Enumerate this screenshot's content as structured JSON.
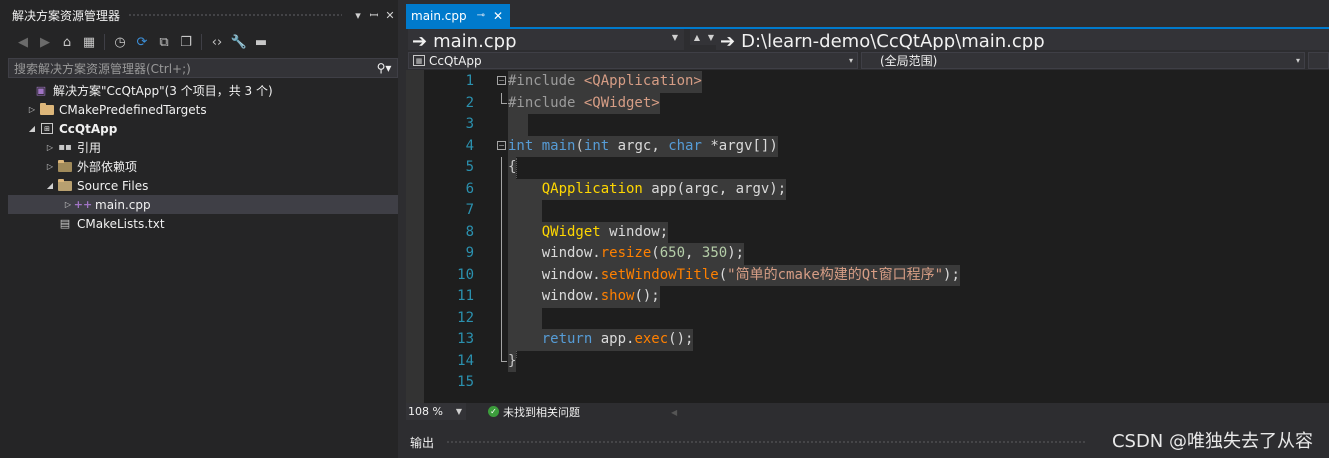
{
  "solution_explorer": {
    "title": "解决方案资源管理器",
    "controls": [
      "▾",
      "ꟷ",
      "✕"
    ],
    "search_placeholder": "搜索解决方案资源管理器(Ctrl+;)",
    "tree": [
      {
        "label": "解决方案\"CcQtApp\"(3 个项目，共 3 个)",
        "icon": "solution-icon",
        "indent": 0,
        "arrow": ""
      },
      {
        "label": "CMakePredefinedTargets",
        "icon": "folder-icon",
        "indent": 1,
        "arrow": "▷"
      },
      {
        "label": "CcQtApp",
        "icon": "project-icon",
        "indent": 1,
        "arrow": "◢",
        "bold": true
      },
      {
        "label": "引用",
        "icon": "references-icon",
        "indent": 2,
        "arrow": "▷"
      },
      {
        "label": "外部依赖项",
        "icon": "external-deps-icon",
        "indent": 2,
        "arrow": "▷"
      },
      {
        "label": "Source Files",
        "icon": "filter-folder-icon",
        "indent": 2,
        "arrow": "◢"
      },
      {
        "label": "main.cpp",
        "icon": "cpp-file-icon",
        "indent": 3,
        "arrow": "▷",
        "selected": true
      },
      {
        "label": "CMakeLists.txt",
        "icon": "text-file-icon",
        "indent": 2,
        "arrow": ""
      }
    ]
  },
  "editor": {
    "tab": {
      "label": "main.cpp",
      "pin": "⊸",
      "close": "✕"
    },
    "nav_file": "main.cpp",
    "nav_path": "D:\\learn-demo\\CcQtApp\\main.cpp",
    "scope_project": "CcQtApp",
    "scope_range": "(全局范围)",
    "line_numbers": [
      "1",
      "2",
      "3",
      "4",
      "5",
      "6",
      "7",
      "8",
      "9",
      "10",
      "11",
      "12",
      "13",
      "14",
      "15"
    ],
    "zoom": "108 %",
    "issues": "未找到相关问题"
  },
  "code_lines": [
    [
      {
        "t": "#include ",
        "c": "pre"
      },
      {
        "t": "<QApplication>",
        "c": "inc"
      }
    ],
    [
      {
        "t": "#include ",
        "c": "pre"
      },
      {
        "t": "<QWidget>",
        "c": "inc"
      }
    ],
    [
      {
        "t": "",
        "c": "pm"
      }
    ],
    [
      {
        "t": "int",
        "c": "kw"
      },
      {
        "t": " ",
        "c": "pm"
      },
      {
        "t": "main",
        "c": "kw"
      },
      {
        "t": "(",
        "c": "pm"
      },
      {
        "t": "int",
        "c": "kw"
      },
      {
        "t": " argc, ",
        "c": "vr"
      },
      {
        "t": "char",
        "c": "kw"
      },
      {
        "t": " *argv[])",
        "c": "vr"
      }
    ],
    [
      {
        "t": "{",
        "c": "pm"
      }
    ],
    [
      {
        "t": "    ",
        "c": "pm"
      },
      {
        "t": "QApplication",
        "c": "ty"
      },
      {
        "t": " app(argc, argv);",
        "c": "vr"
      }
    ],
    [
      {
        "t": "    ",
        "c": "pm"
      }
    ],
    [
      {
        "t": "    ",
        "c": "pm"
      },
      {
        "t": "QWidget",
        "c": "ty"
      },
      {
        "t": " window;",
        "c": "vr"
      }
    ],
    [
      {
        "t": "    window.",
        "c": "vr"
      },
      {
        "t": "resize",
        "c": "fn"
      },
      {
        "t": "(",
        "c": "vr"
      },
      {
        "t": "650",
        "c": "num"
      },
      {
        "t": ", ",
        "c": "vr"
      },
      {
        "t": "350",
        "c": "num"
      },
      {
        "t": ");",
        "c": "vr"
      }
    ],
    [
      {
        "t": "    window.",
        "c": "vr"
      },
      {
        "t": "setWindowTitle",
        "c": "fn"
      },
      {
        "t": "(",
        "c": "vr"
      },
      {
        "t": "\"简单的cmake构建的Qt窗口程序\"",
        "c": "str"
      },
      {
        "t": ");",
        "c": "vr"
      }
    ],
    [
      {
        "t": "    window.",
        "c": "vr"
      },
      {
        "t": "show",
        "c": "fn"
      },
      {
        "t": "();",
        "c": "vr"
      }
    ],
    [
      {
        "t": "    ",
        "c": "pm"
      }
    ],
    [
      {
        "t": "    ",
        "c": "pm"
      },
      {
        "t": "return",
        "c": "kw"
      },
      {
        "t": " app.",
        "c": "vr"
      },
      {
        "t": "exec",
        "c": "fn"
      },
      {
        "t": "();",
        "c": "vr"
      }
    ],
    [
      {
        "t": "}",
        "c": "pm"
      }
    ],
    [
      {
        "t": "",
        "c": "pm"
      }
    ]
  ],
  "output": {
    "title": "输出"
  },
  "watermark": "CSDN @唯独失去了从容",
  "colors": {
    "accent": "#007acc",
    "background": "#1e1e1e",
    "panel": "#252526"
  }
}
